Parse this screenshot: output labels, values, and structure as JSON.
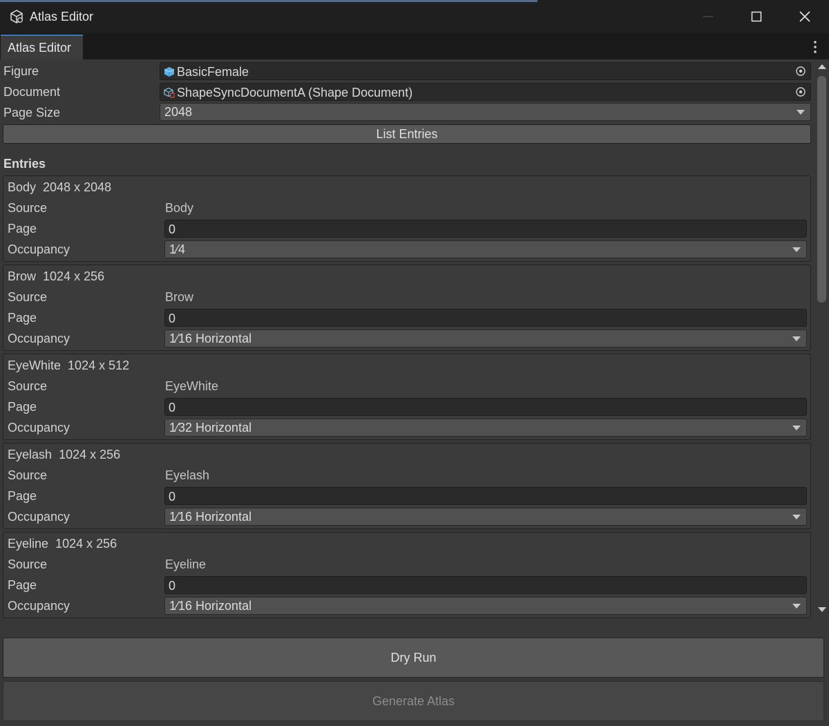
{
  "window": {
    "title": "Atlas Editor",
    "icon": "unity-cubes-icon"
  },
  "tabs": [
    {
      "label": "Atlas Editor",
      "active": true
    }
  ],
  "form": {
    "figure": {
      "label": "Figure",
      "value": "BasicFemale",
      "icon": "prefab-cube-icon"
    },
    "document": {
      "label": "Document",
      "value": "ShapeSyncDocumentA (Shape Document)",
      "icon": "scriptable-object-icon"
    },
    "page_size": {
      "label": "Page Size",
      "value": "2048"
    },
    "list_entries_button": "List Entries"
  },
  "entries_section": {
    "title": "Entries",
    "field_labels": {
      "source": "Source",
      "page": "Page",
      "occupancy": "Occupancy"
    },
    "items": [
      {
        "name": "Body",
        "size": "2048 x 2048",
        "source": "Body",
        "page": "0",
        "occupancy": "1⁄4"
      },
      {
        "name": "Brow",
        "size": "1024 x 256",
        "source": "Brow",
        "page": "0",
        "occupancy": "1⁄16 Horizontal"
      },
      {
        "name": "EyeWhite",
        "size": "1024 x 512",
        "source": "EyeWhite",
        "page": "0",
        "occupancy": "1⁄32 Horizontal"
      },
      {
        "name": "Eyelash",
        "size": "1024 x 256",
        "source": "Eyelash",
        "page": "0",
        "occupancy": "1⁄16 Horizontal"
      },
      {
        "name": "Eyeline",
        "size": "1024 x 256",
        "source": "Eyeline",
        "page": "0",
        "occupancy": "1⁄16 Horizontal"
      }
    ]
  },
  "actions": {
    "dry_run": "Dry Run",
    "generate_atlas": "Generate Atlas",
    "generate_enabled": false
  },
  "colors": {
    "accent": "#3a79bb",
    "panel": "#383838",
    "field": "#2a2a2a",
    "button": "#585858"
  }
}
